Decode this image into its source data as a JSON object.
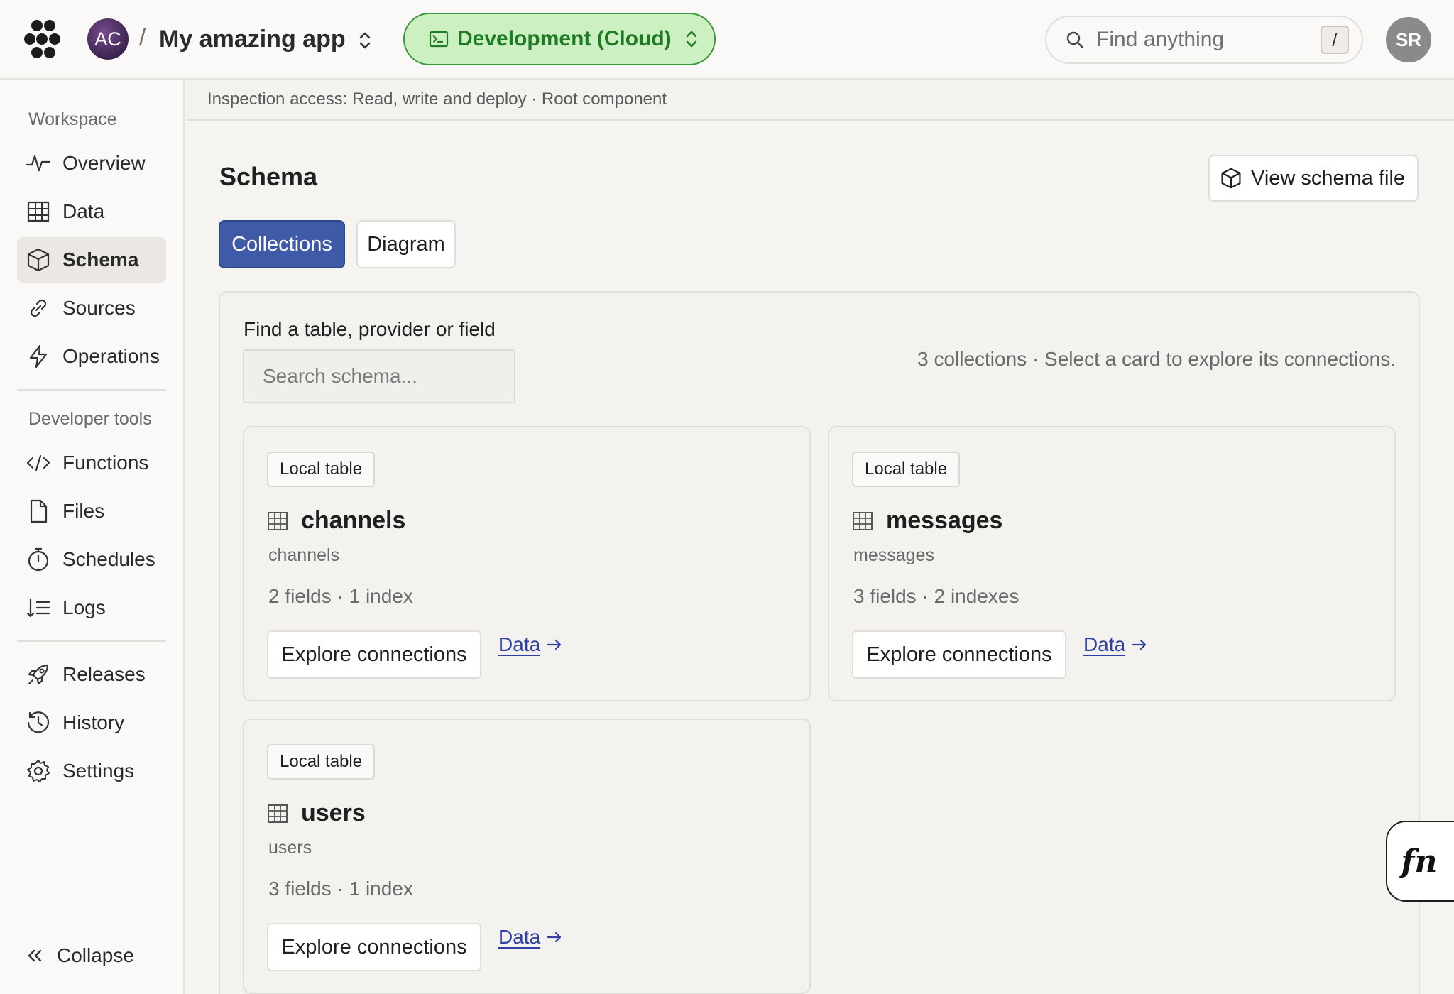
{
  "header": {
    "team_initials": "AC",
    "separator": "/",
    "project_name": "My amazing app",
    "deployment": "Development (Cloud)",
    "search_placeholder": "Find anything",
    "search_shortcut": "/",
    "user_initials": "SR",
    "colors": {
      "deployment_bg": "#cdf0c3",
      "deployment_text": "#1f7a24",
      "team_avatar": "#5a3570",
      "user_avatar": "#8a8a8a"
    }
  },
  "sidebar": {
    "workspace_heading": "Workspace",
    "workspace_items": [
      {
        "label": "Overview",
        "icon": "activity-icon"
      },
      {
        "label": "Data",
        "icon": "table-icon"
      },
      {
        "label": "Schema",
        "icon": "cube-icon",
        "active": true
      },
      {
        "label": "Sources",
        "icon": "link-icon"
      },
      {
        "label": "Operations",
        "icon": "lightning-icon"
      }
    ],
    "devtools_heading": "Developer tools",
    "devtools_items": [
      {
        "label": "Functions",
        "icon": "code-icon"
      },
      {
        "label": "Files",
        "icon": "file-icon"
      },
      {
        "label": "Schedules",
        "icon": "stopwatch-icon"
      },
      {
        "label": "Logs",
        "icon": "logs-icon"
      }
    ],
    "other_items": [
      {
        "label": "Releases",
        "icon": "rocket-icon"
      },
      {
        "label": "History",
        "icon": "history-icon"
      },
      {
        "label": "Settings",
        "icon": "gear-icon"
      }
    ],
    "collapse_label": "Collapse"
  },
  "infobar": {
    "text": "Inspection access: Read, write and deploy · Root component"
  },
  "main": {
    "title": "Schema",
    "view_schema_button": "View schema file",
    "tabs": [
      {
        "label": "Collections",
        "active": true
      },
      {
        "label": "Diagram",
        "active": false
      }
    ],
    "filter_label": "Find a table, provider or field",
    "filter_placeholder": "Search schema...",
    "summary": "3 collections · Select a card to explore its connections.",
    "cards": [
      {
        "badge": "Local table",
        "name": "channels",
        "subtitle": "channels",
        "stats": "2 fields · 1 index",
        "explore_label": "Explore connections",
        "data_link": "Data"
      },
      {
        "badge": "Local table",
        "name": "messages",
        "subtitle": "messages",
        "stats": "3 fields · 2 indexes",
        "explore_label": "Explore connections",
        "data_link": "Data"
      },
      {
        "badge": "Local table",
        "name": "users",
        "subtitle": "users",
        "stats": "3 fields · 1 index",
        "explore_label": "Explore connections",
        "data_link": "Data"
      }
    ],
    "accent_color": "#3f5aa6",
    "link_color": "#2f3fa5"
  },
  "fn_button": {
    "label": "fn"
  }
}
